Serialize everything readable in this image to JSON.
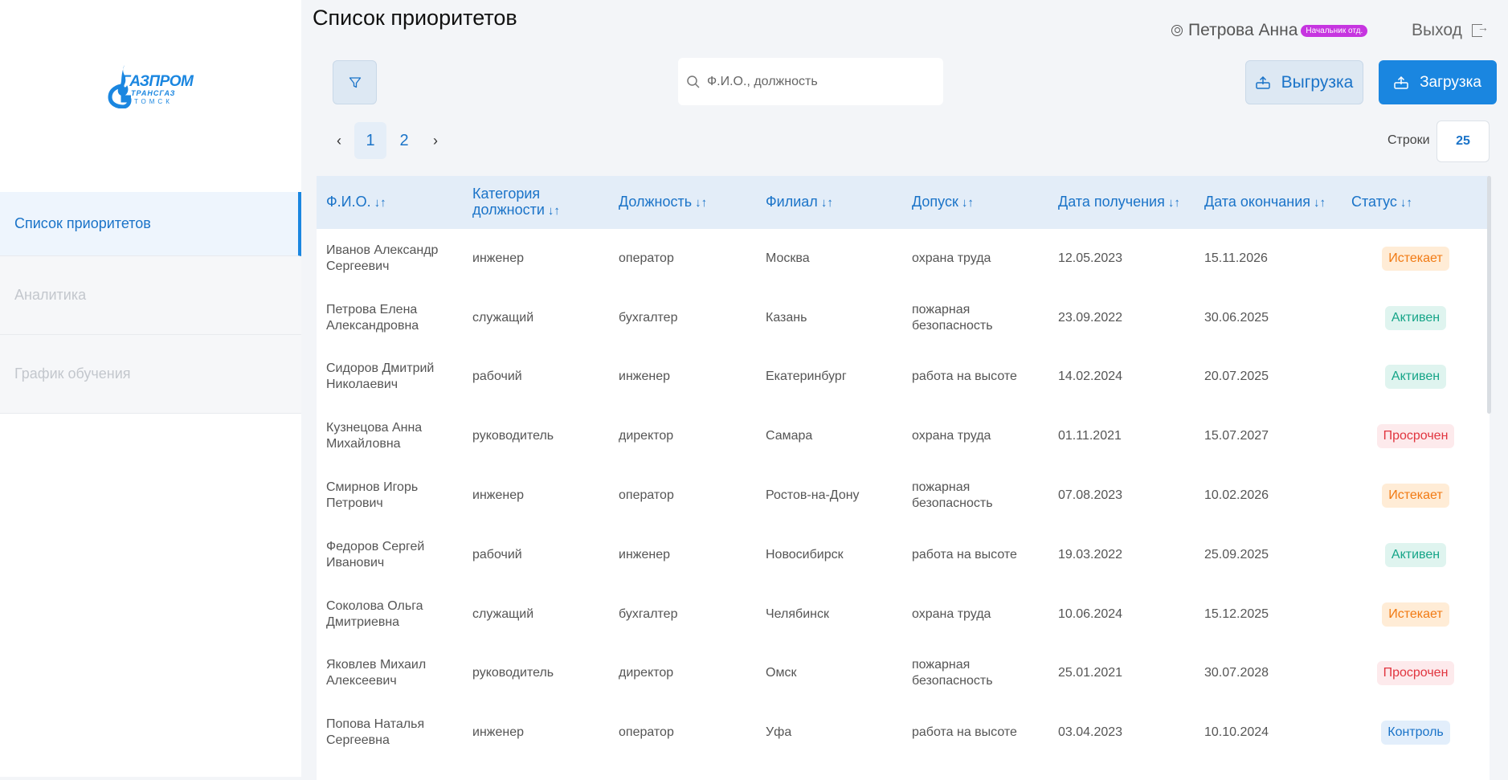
{
  "app": {
    "logo_text": "ГАЗПРОМ",
    "logo_sub1": "ТРАНСГАЗ",
    "logo_sub2": "ТОМСК"
  },
  "sidebar": {
    "items": [
      {
        "label": "Список приоритетов",
        "active": true
      },
      {
        "label": "Аналитика",
        "active": false
      },
      {
        "label": "График обучения",
        "active": false
      }
    ]
  },
  "header": {
    "title": "Список приоритетов",
    "user_name": "Петрова Анна",
    "user_role": "Начальник отд.",
    "logout_label": "Выход"
  },
  "toolbar": {
    "search_placeholder": "Ф.И.О., должность",
    "export_label": "Выгрузка",
    "import_label": "Загрузка"
  },
  "pagination": {
    "pages": [
      "1",
      "2"
    ],
    "current": "1",
    "prev_icon": "chevron-left-icon",
    "next_icon": "chevron-right-icon",
    "rows_label": "Строки",
    "rows_value": "25"
  },
  "table": {
    "headers": [
      "Ф.И.О.",
      "Категория должности",
      "Должность",
      "Филиал",
      "Допуск",
      "Дата получения",
      "Дата окончания",
      "Статус"
    ],
    "rows": [
      {
        "name": "Иванов Александр Сергеевич",
        "category": "инженер",
        "position": "оператор",
        "branch": "Москва",
        "access": "охрана труда",
        "received": "12.05.2023",
        "expires": "15.11.2026",
        "status": "Истекает",
        "status_type": "warn"
      },
      {
        "name": "Петрова Елена Александровна",
        "category": "служащий",
        "position": "бухгалтер",
        "branch": "Казань",
        "access": "пожарная безопасность",
        "received": "23.09.2022",
        "expires": "30.06.2025",
        "status": "Активен",
        "status_type": "ok"
      },
      {
        "name": "Сидоров Дмитрий Николаевич",
        "category": "рабочий",
        "position": "инженер",
        "branch": "Екатеринбург",
        "access": "работа на высоте",
        "received": "14.02.2024",
        "expires": "20.07.2025",
        "status": "Активен",
        "status_type": "ok"
      },
      {
        "name": "Кузнецова Анна Михайловна",
        "category": "руководитель",
        "position": "директор",
        "branch": "Самара",
        "access": "охрана труда",
        "received": "01.11.2021",
        "expires": "15.07.2027",
        "status": "Просрочен",
        "status_type": "bad"
      },
      {
        "name": "Смирнов Игорь Петрович",
        "category": "инженер",
        "position": "оператор",
        "branch": "Ростов-на-Дону",
        "access": "пожарная безопасность",
        "received": "07.08.2023",
        "expires": "10.02.2026",
        "status": "Истекает",
        "status_type": "warn"
      },
      {
        "name": "Федоров Сергей Иванович",
        "category": "рабочий",
        "position": "инженер",
        "branch": "Новосибирск",
        "access": "работа на высоте",
        "received": "19.03.2022",
        "expires": "25.09.2025",
        "status": "Активен",
        "status_type": "ok"
      },
      {
        "name": "Соколова Ольга Дмитриевна",
        "category": "служащий",
        "position": "бухгалтер",
        "branch": "Челябинск",
        "access": "охрана труда",
        "received": "10.06.2024",
        "expires": "15.12.2025",
        "status": "Истекает",
        "status_type": "warn"
      },
      {
        "name": "Яковлев Михаил Алексеевич",
        "category": "руководитель",
        "position": "директор",
        "branch": "Омск",
        "access": "пожарная безопасность",
        "received": "25.01.2021",
        "expires": "30.07.2028",
        "status": "Просрочен",
        "status_type": "bad"
      },
      {
        "name": "Попова Наталья Сергеевна",
        "category": "инженер",
        "position": "оператор",
        "branch": "Уфа",
        "access": "работа на высоте",
        "received": "03.04.2023",
        "expires": "10.10.2024",
        "status": "Контроль",
        "status_type": "ctrl"
      }
    ]
  },
  "colors": {
    "accent": "#1a86e0",
    "status_warn": "#f17a13",
    "status_ok": "#16a588",
    "status_bad": "#e1353f",
    "status_ctrl": "#1a73c8",
    "role_badge": "#c635e0"
  }
}
